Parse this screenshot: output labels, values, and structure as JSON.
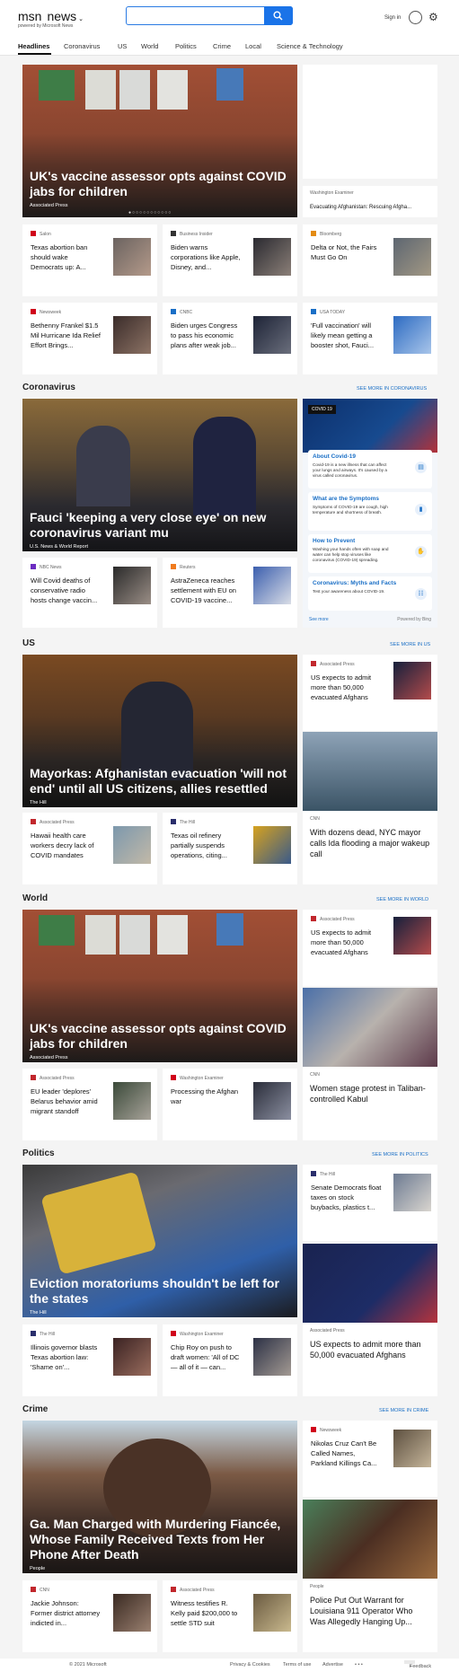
{
  "header": {
    "brand": "msn",
    "product": "news",
    "tagline": "powered by Microsoft News",
    "search_placeholder": "",
    "signin": "Sign in"
  },
  "nav": [
    "Headlines",
    "Coronavirus",
    "US",
    "World",
    "Politics",
    "Crime",
    "Local",
    "Science & Technology"
  ],
  "headlines": {
    "hero": {
      "title": "UK's vaccine assessor opts against COVID jabs for children",
      "source": "Associated Press"
    },
    "side": {
      "source": "Washington Examiner",
      "title": "Evacuating Afghanistan: Rescuing Afgha..."
    },
    "small": [
      {
        "source": "Salon",
        "title": "Texas abortion ban should wake Democrats up: A..."
      },
      {
        "source": "Business Insider",
        "title": "Biden warns corporations like Apple, Disney, and..."
      },
      {
        "source": "Bloomberg",
        "title": "Delta or Not, the Fairs Must Go On"
      },
      {
        "source": "Newsweek",
        "title": "Bethenny Frankel $1.5 Mil Hurricane Ida Relief Effort Brings..."
      },
      {
        "source": "CNBC",
        "title": "Biden urges Congress to pass his economic plans after weak job..."
      },
      {
        "source": "USA TODAY",
        "title": "'Full vaccination' will likely mean getting a booster shot, Fauci..."
      }
    ]
  },
  "coronavirus": {
    "heading": "Coronavirus",
    "more": "See more in Coronavirus",
    "hero": {
      "title": "Fauci 'keeping a very close eye' on new coronavirus variant mu",
      "source": "U.S. News & World Report"
    },
    "panel": {
      "badge": "COVID 19",
      "see_more": "See more",
      "powered": "Powered by Bing",
      "rows": [
        {
          "title": "About Covid-19",
          "text": "Covid-19 is a new illness that can affect your lungs and airways. It's caused by a virus called coronavirus."
        },
        {
          "title": "What are the Symptoms",
          "text": "Symptoms of COVID-19 are cough, high temperature and shortness of breath."
        },
        {
          "title": "How to Prevent",
          "text": "Washing your hands often with soap and water can help stop viruses like coronavirus (COVID-19) spreading."
        },
        {
          "title": "Coronavirus: Myths and Facts",
          "text": "Test your awareness about COVID-19."
        }
      ]
    },
    "small": [
      {
        "source": "NBC News",
        "title": "Will Covid deaths of conservative radio hosts change vaccin..."
      },
      {
        "source": "Reuters",
        "title": "AstraZeneca reaches settlement with EU on COVID-19 vaccine..."
      }
    ]
  },
  "us": {
    "heading": "US",
    "more": "See more in US",
    "hero": {
      "title": "Mayorkas: Afghanistan evacuation 'will not end' until all US citizens, allies resettled",
      "source": "The Hill"
    },
    "side": {
      "source": "Associated Press",
      "title": "US expects to admit more than 50,000 evacuated Afghans"
    },
    "tall": {
      "source": "CNN",
      "title": "With dozens dead, NYC mayor calls Ida flooding a major wakeup call"
    },
    "small": [
      {
        "source": "Associated Press",
        "title": "Hawaii health care workers decry lack of COVID mandates"
      },
      {
        "source": "The Hill",
        "title": "Texas oil refinery partially suspends operations, citing..."
      }
    ]
  },
  "world": {
    "heading": "World",
    "more": "See more in World",
    "hero": {
      "title": "UK's vaccine assessor opts against COVID jabs for children",
      "source": "Associated Press"
    },
    "side": {
      "source": "Associated Press",
      "title": "US expects to admit more than 50,000 evacuated Afghans"
    },
    "tall": {
      "source": "CNN",
      "title": "Women stage protest in Taliban-controlled Kabul"
    },
    "small": [
      {
        "source": "Associated Press",
        "title": "EU leader 'deplores' Belarus behavior amid migrant standoff"
      },
      {
        "source": "Washington Examiner",
        "title": "Processing the Afghan war"
      }
    ]
  },
  "politics": {
    "heading": "Politics",
    "more": "See more in Politics",
    "hero": {
      "title": "Eviction moratoriums shouldn't be left for the states",
      "source": "The Hill"
    },
    "side": {
      "source": "The Hill",
      "title": "Senate Democrats float taxes on stock buybacks, plastics t..."
    },
    "tall": {
      "source": "Associated Press",
      "title": "US expects to admit more than 50,000 evacuated Afghans"
    },
    "small": [
      {
        "source": "The Hill",
        "title": "Illinois governor blasts Texas abortion law: 'Shame on'..."
      },
      {
        "source": "Washington Examiner",
        "title": "Chip Roy on push to draft women: 'All of DC — all of it — can..."
      }
    ]
  },
  "crime": {
    "heading": "Crime",
    "more": "See more in Crime",
    "hero": {
      "title": "Ga. Man Charged with Murdering Fiancée, Whose Family Received Texts from Her Phone After Death",
      "source": "People"
    },
    "side": {
      "source": "Newsweek",
      "title": "Nikolas Cruz Can't Be Called Names, Parkland Killings Ca..."
    },
    "tall": {
      "source": "People",
      "title": "Police Put Out Warrant for Louisiana 911 Operator Who Was Allegedly Hanging Up..."
    },
    "small": [
      {
        "source": "CNN",
        "title": "Jackie Johnson: Former district attorney indicted in..."
      },
      {
        "source": "Associated Press",
        "title": "Witness testifies R. Kelly paid $200,000 to settle STD suit"
      }
    ]
  },
  "footer": {
    "copy": "© 2021 Microsoft",
    "privacy": "Privacy & Cookies",
    "terms": "Terms of use",
    "advertise": "Advertise",
    "dots": "• • •",
    "feedback": "Feedback"
  }
}
